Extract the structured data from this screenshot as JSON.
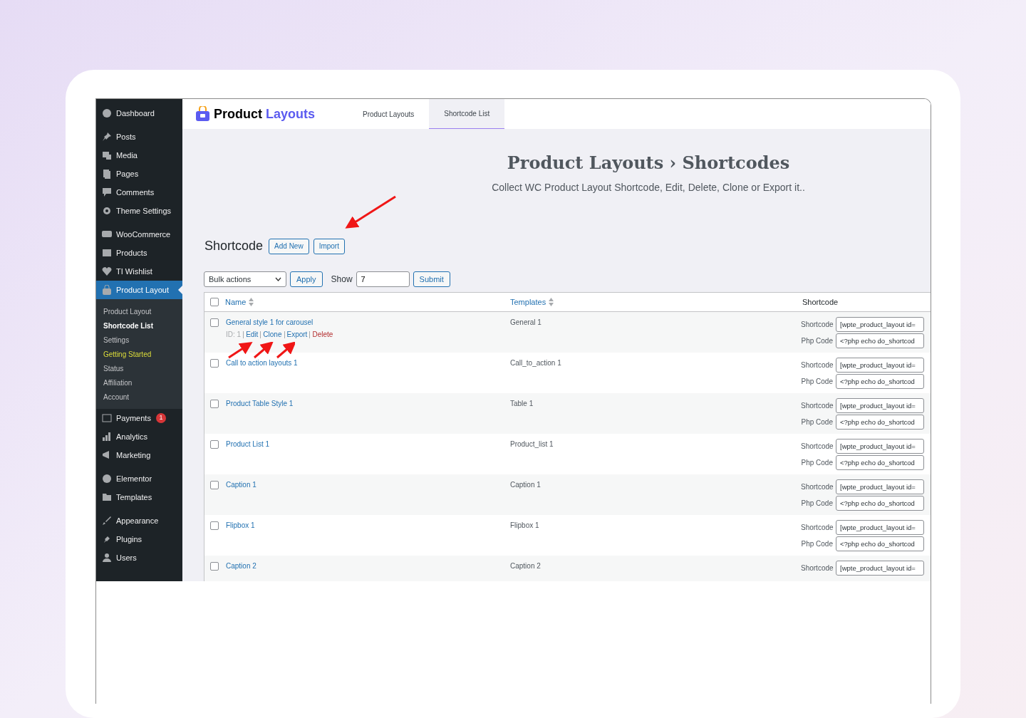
{
  "sidebar": {
    "groups": [
      {
        "items": [
          {
            "label": "Dashboard",
            "selected": false
          }
        ]
      },
      {
        "items": [
          {
            "label": "Posts",
            "selected": false
          },
          {
            "label": "Media",
            "selected": false
          },
          {
            "label": "Pages",
            "selected": false
          },
          {
            "label": "Comments",
            "selected": false
          },
          {
            "label": "Theme Settings",
            "selected": false
          }
        ]
      },
      {
        "items": [
          {
            "label": "WooCommerce",
            "selected": false
          },
          {
            "label": "Products",
            "selected": false
          },
          {
            "label": "TI Wishlist",
            "selected": false
          },
          {
            "label": "Product Layout",
            "selected": true,
            "submenu": [
              {
                "label": "Product Layout",
                "selected": false,
                "kind": "normal"
              },
              {
                "label": "Shortcode List",
                "selected": true,
                "kind": "normal"
              },
              {
                "label": "Settings",
                "selected": false,
                "kind": "normal"
              },
              {
                "label": "Getting Started",
                "selected": false,
                "kind": "highlight"
              },
              {
                "label": "Status",
                "selected": false,
                "kind": "normal"
              },
              {
                "label": "Affiliation",
                "selected": false,
                "kind": "normal"
              },
              {
                "label": "Account",
                "selected": false,
                "kind": "normal"
              }
            ]
          }
        ]
      },
      {
        "items": [
          {
            "label": "Payments",
            "selected": false,
            "badge": "1"
          },
          {
            "label": "Analytics",
            "selected": false
          },
          {
            "label": "Marketing",
            "selected": false
          }
        ]
      },
      {
        "items": [
          {
            "label": "Elementor",
            "selected": false
          },
          {
            "label": "Templates",
            "selected": false
          }
        ]
      },
      {
        "items": [
          {
            "label": "Appearance",
            "selected": false
          },
          {
            "label": "Plugins",
            "selected": false
          },
          {
            "label": "Users",
            "selected": false
          }
        ]
      }
    ]
  },
  "header": {
    "brand": "Product",
    "brand_accent": "Layouts",
    "tabs": [
      {
        "label": "Product Layouts",
        "selected": false
      },
      {
        "label": "Shortcode List",
        "selected": true
      }
    ]
  },
  "hero": {
    "title": "Product Layouts › Shortcodes",
    "subtitle": "Collect WC Product Layout Shortcode, Edit, Delete, Clone or Export it.."
  },
  "section": {
    "title": "Shortcode",
    "buttons": [
      "Add New",
      "Import"
    ]
  },
  "toolbar": {
    "bulk": "Bulk actions",
    "apply": "Apply",
    "show_label": "Show",
    "show_value": "7",
    "submit": "Submit"
  },
  "table": {
    "select_all_checked": false,
    "columns": [
      "Name",
      "Templates",
      "Shortcode"
    ],
    "rows": [
      {
        "name": "General style 1 for carousel",
        "template": "General 1",
        "checked": false,
        "actions": [
          {
            "label": "ID: 1",
            "kind": "id"
          },
          {
            "label": "Edit",
            "kind": "link"
          },
          {
            "label": "Clone",
            "kind": "link"
          },
          {
            "label": "Export",
            "kind": "link"
          },
          {
            "label": "Delete",
            "kind": "danger"
          }
        ],
        "codes": [
          {
            "label": "Shortcode",
            "value": "[wpte_product_layout id="
          },
          {
            "label": "Php Code",
            "value": "<?php echo do_shortcod"
          }
        ]
      },
      {
        "name": "Call to action layouts 1",
        "template": "Call_to_action 1",
        "checked": false,
        "codes": [
          {
            "label": "Shortcode",
            "value": "[wpte_product_layout id="
          },
          {
            "label": "Php Code",
            "value": "<?php echo do_shortcod"
          }
        ]
      },
      {
        "name": "Product Table Style 1",
        "template": "Table 1",
        "checked": false,
        "codes": [
          {
            "label": "Shortcode",
            "value": "[wpte_product_layout id="
          },
          {
            "label": "Php Code",
            "value": "<?php echo do_shortcod"
          }
        ]
      },
      {
        "name": "Product List 1",
        "template": "Product_list 1",
        "checked": false,
        "codes": [
          {
            "label": "Shortcode",
            "value": "[wpte_product_layout id="
          },
          {
            "label": "Php Code",
            "value": "<?php echo do_shortcod"
          }
        ]
      },
      {
        "name": "Caption 1",
        "template": "Caption 1",
        "checked": false,
        "codes": [
          {
            "label": "Shortcode",
            "value": "[wpte_product_layout id="
          },
          {
            "label": "Php Code",
            "value": "<?php echo do_shortcod"
          }
        ]
      },
      {
        "name": "Flipbox 1",
        "template": "Flipbox 1",
        "checked": false,
        "codes": [
          {
            "label": "Shortcode",
            "value": "[wpte_product_layout id="
          },
          {
            "label": "Php Code",
            "value": "<?php echo do_shortcod"
          }
        ]
      },
      {
        "name": "Caption 2",
        "template": "Caption 2",
        "checked": false,
        "codes": [
          {
            "label": "Shortcode",
            "value": "[wpte_product_layout id="
          }
        ]
      }
    ]
  }
}
